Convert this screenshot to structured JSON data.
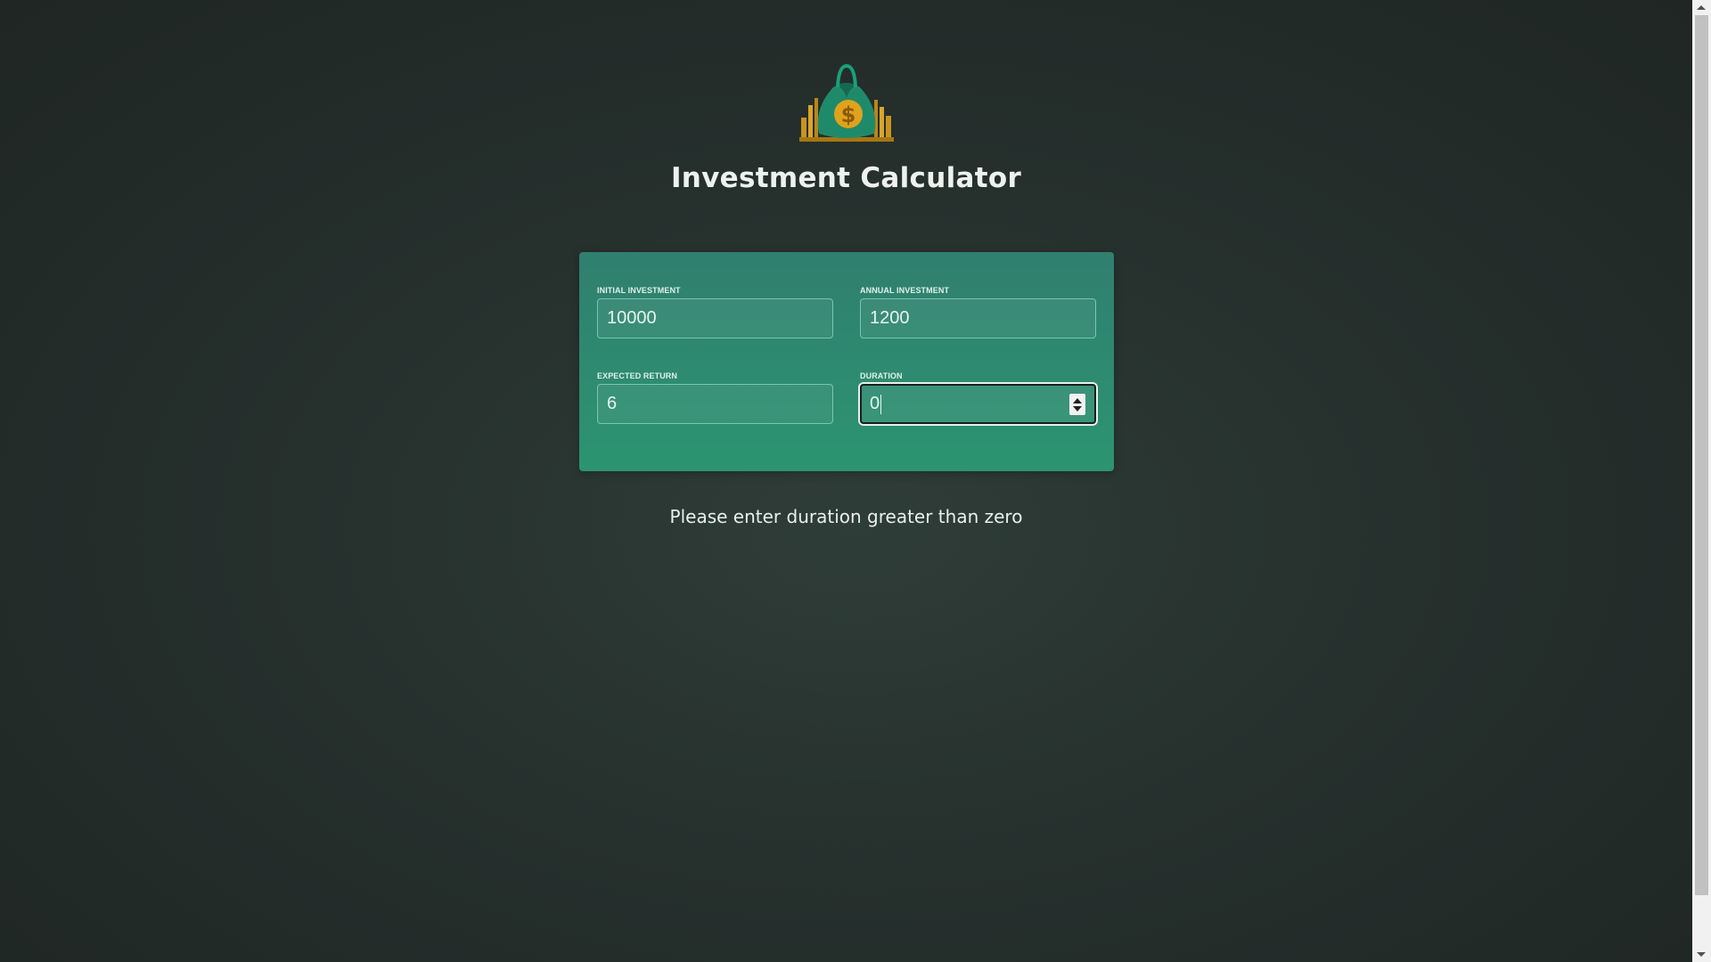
{
  "header": {
    "logo_icon": "money-bag-icon",
    "title": "Investment Calculator"
  },
  "form": {
    "initial_investment": {
      "label": "Initial Investment",
      "value": "10000"
    },
    "annual_investment": {
      "label": "Annual Investment",
      "value": "1200"
    },
    "expected_return": {
      "label": "Expected Return",
      "value": "6"
    },
    "duration": {
      "label": "Duration",
      "value": "0"
    }
  },
  "message": "Please enter duration greater than zero",
  "colors": {
    "card_top": "#307f6f",
    "card_bottom": "#2c9470",
    "background": "#26302d",
    "text": "#e8efec"
  }
}
